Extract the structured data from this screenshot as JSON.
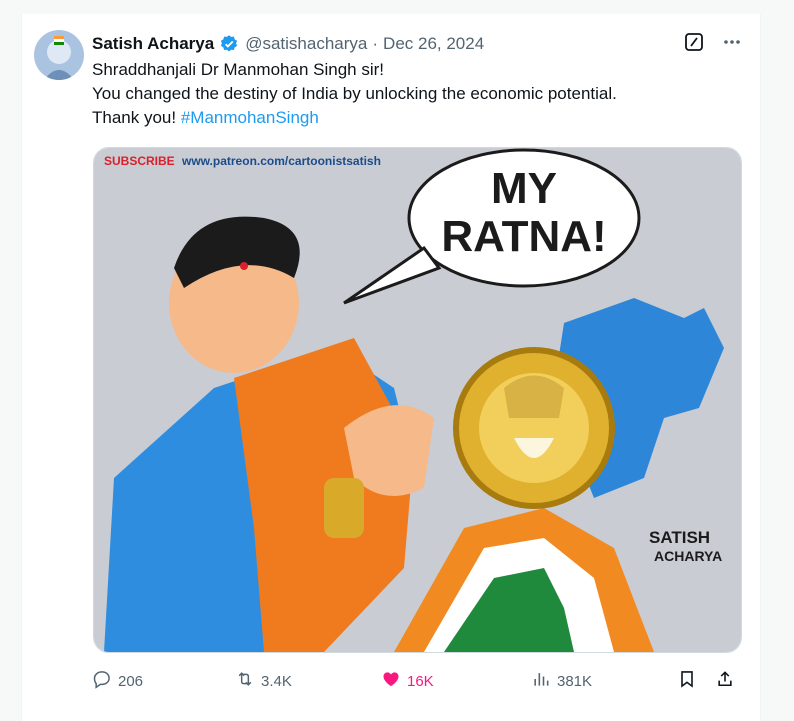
{
  "tweet": {
    "author_name": "Satish Acharya",
    "handle": "@satishacharya",
    "separator": "·",
    "date": "Dec 26, 2024",
    "text_line1": "Shraddhanjali Dr Manmohan Singh sir!",
    "text_line2": "You changed the destiny of India by unlocking the economic potential.",
    "text_line3_prefix": "Thank you! ",
    "hashtag": "#ManmohanSingh"
  },
  "media": {
    "subscribe_label": "SUBSCRIBE",
    "patreon_url": "www.patreon.com/cartoonistsatish",
    "speech_line1": "MY",
    "speech_line2": "RATNA!",
    "signature_line1": "SATISH",
    "signature_line2": "ACHARYA"
  },
  "actions": {
    "replies": "206",
    "reposts": "3.4K",
    "likes": "16K",
    "views": "381K"
  },
  "colors": {
    "accent": "#1d9bf0",
    "like": "#f91880",
    "muted": "#536471"
  },
  "icons": [
    "verified-badge-icon",
    "grok-icon",
    "more-icon",
    "reply-icon",
    "repost-icon",
    "heart-icon",
    "views-icon",
    "bookmark-icon",
    "share-icon"
  ]
}
